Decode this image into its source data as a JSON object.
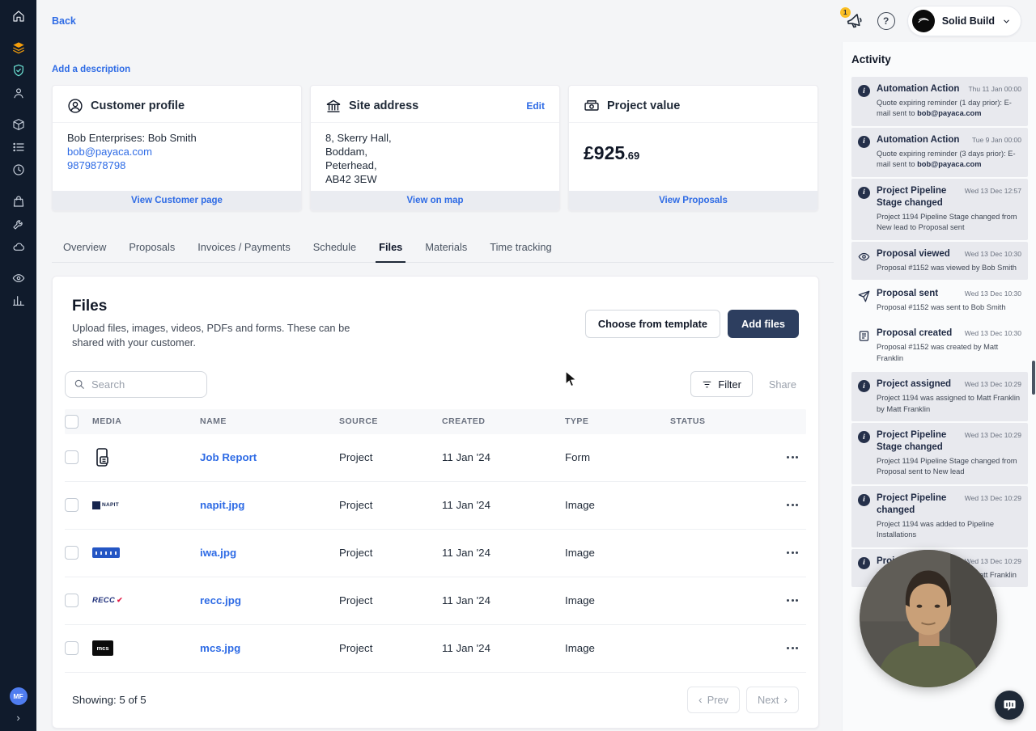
{
  "topbar": {
    "back_label": "Back",
    "notification_count": "1",
    "org_name": "Solid Build"
  },
  "sidebar": {
    "avatar_initials": "MF"
  },
  "description": {
    "add_label": "Add a description"
  },
  "cards": {
    "customer": {
      "title": "Customer profile",
      "contact": "Bob Enterprises: Bob Smith",
      "email": "bob@payaca.com",
      "phone": "9879878798",
      "footer_link": "View Customer page"
    },
    "site": {
      "title": "Site address",
      "edit_label": "Edit",
      "address_line1": "8, Skerry Hall,",
      "address_line2": "Boddam,",
      "address_line3": "Peterhead,",
      "address_line4": "AB42 3EW",
      "footer_link": "View on map"
    },
    "project_value": {
      "title": "Project value",
      "amount": "£925",
      "cents": ".69",
      "footer_link": "View Proposals"
    }
  },
  "tabs": [
    {
      "label": "Overview"
    },
    {
      "label": "Proposals"
    },
    {
      "label": "Invoices / Payments"
    },
    {
      "label": "Schedule"
    },
    {
      "label": "Files"
    },
    {
      "label": "Materials"
    },
    {
      "label": "Time tracking"
    }
  ],
  "files": {
    "title": "Files",
    "subtitle": "Upload files, images, videos, PDFs and forms. These can be shared with your customer.",
    "choose_template_label": "Choose from template",
    "add_files_label": "Add files",
    "search_placeholder": "Search",
    "filter_label": "Filter",
    "share_label": "Share",
    "headers": {
      "media": "MEDIA",
      "name": "NAME",
      "source": "SOURCE",
      "created": "CREATED",
      "type": "TYPE",
      "status": "STATUS"
    },
    "rows": [
      {
        "name": "Job Report",
        "source": "Project",
        "created": "11 Jan '24",
        "type": "Form"
      },
      {
        "name": "napit.jpg",
        "source": "Project",
        "created": "11 Jan '24",
        "type": "Image",
        "thumb_text": "NAPIT"
      },
      {
        "name": "iwa.jpg",
        "source": "Project",
        "created": "11 Jan '24",
        "type": "Image"
      },
      {
        "name": "recc.jpg",
        "source": "Project",
        "created": "11 Jan '24",
        "type": "Image",
        "thumb_text": "RECC"
      },
      {
        "name": "mcs.jpg",
        "source": "Project",
        "created": "11 Jan '24",
        "type": "Image",
        "thumb_text": "mcs"
      }
    ],
    "showing_label": "Showing: 5 of 5",
    "prev_label": "Prev",
    "next_label": "Next"
  },
  "activity": {
    "title": "Activity",
    "items": [
      {
        "title": "Automation Action",
        "time": "Thu 11 Jan 00:00",
        "desc": "Quote expiring reminder (1 day prior): E-mail sent to ",
        "desc_bold": "bob@payaca.com",
        "highlighted": true
      },
      {
        "title": "Automation Action",
        "time": "Tue 9 Jan 00:00",
        "desc": "Quote expiring reminder (3 days prior): E-mail sent to ",
        "desc_bold": "bob@payaca.com",
        "highlighted": true
      },
      {
        "title": "Project Pipeline Stage changed",
        "time": "Wed 13 Dec 12:57",
        "desc": "Project 1194 Pipeline Stage changed from New lead to Proposal sent",
        "highlighted": true
      },
      {
        "title": "Proposal viewed",
        "time": "Wed 13 Dec 10:30",
        "desc": "Proposal #1152 was viewed by Bob Smith",
        "highlighted": true
      },
      {
        "title": "Proposal sent",
        "time": "Wed 13 Dec 10:30",
        "desc": "Proposal #1152 was sent to Bob Smith",
        "highlighted": false
      },
      {
        "title": "Proposal created",
        "time": "Wed 13 Dec 10:30",
        "desc": "Proposal #1152 was created by Matt Franklin",
        "highlighted": false
      },
      {
        "title": "Project assigned",
        "time": "Wed 13 Dec 10:29",
        "desc": "Project 1194 was assigned to Matt Franklin by Matt Franklin",
        "highlighted": true
      },
      {
        "title": "Project Pipeline Stage changed",
        "time": "Wed 13 Dec 10:29",
        "desc": "Project 1194 Pipeline Stage changed from Proposal sent to New lead",
        "highlighted": true
      },
      {
        "title": "Project Pipeline changed",
        "time": "Wed 13 Dec 10:29",
        "desc": "Project 1194 was added to Pipeline Installations",
        "highlighted": true
      },
      {
        "title": "Project created",
        "time": "Wed 13 Dec 10:29",
        "desc": "Project 1194 was created by Matt Franklin",
        "highlighted": true
      }
    ]
  },
  "colors": {
    "accent_blue": "#2e6be5",
    "sidebar_bg": "#101b2c",
    "primary_button_bg": "#2d3e5f",
    "activity_highlight_bg": "#e8e9ee",
    "notification_badge": "#fbbf24"
  }
}
